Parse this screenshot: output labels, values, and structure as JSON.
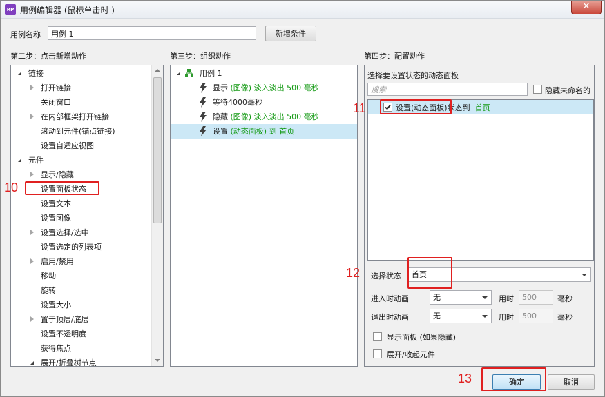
{
  "window": {
    "title": "用例编辑器 (鼠标单击时 )",
    "app_icon": "RP",
    "close_glyph": "✕"
  },
  "case_name": {
    "label": "用例名称",
    "value": "用例 1",
    "add_condition": "新增条件"
  },
  "step2": {
    "heading": "第二步：点击新增动作",
    "tree": [
      {
        "label": "链接",
        "level": 0,
        "expander": "open"
      },
      {
        "label": "打开链接",
        "level": 1,
        "expander": "closed"
      },
      {
        "label": "关闭窗口",
        "level": 1,
        "expander": "none"
      },
      {
        "label": "在内部框架打开链接",
        "level": 1,
        "expander": "closed"
      },
      {
        "label": "滚动到元件(锚点链接)",
        "level": 1,
        "expander": "none"
      },
      {
        "label": "设置自适应视图",
        "level": 1,
        "expander": "none"
      },
      {
        "label": "元件",
        "level": 0,
        "expander": "open"
      },
      {
        "label": "显示/隐藏",
        "level": 1,
        "expander": "closed"
      },
      {
        "label": "设置面板状态",
        "level": 1,
        "expander": "none"
      },
      {
        "label": "设置文本",
        "level": 1,
        "expander": "none"
      },
      {
        "label": "设置图像",
        "level": 1,
        "expander": "none"
      },
      {
        "label": "设置选择/选中",
        "level": 1,
        "expander": "closed"
      },
      {
        "label": "设置选定的列表项",
        "level": 1,
        "expander": "none"
      },
      {
        "label": "启用/禁用",
        "level": 1,
        "expander": "closed"
      },
      {
        "label": "移动",
        "level": 1,
        "expander": "none"
      },
      {
        "label": "旋转",
        "level": 1,
        "expander": "none"
      },
      {
        "label": "设置大小",
        "level": 1,
        "expander": "none"
      },
      {
        "label": "置于顶层/底层",
        "level": 1,
        "expander": "closed"
      },
      {
        "label": "设置不透明度",
        "level": 1,
        "expander": "none"
      },
      {
        "label": "获得焦点",
        "level": 1,
        "expander": "none"
      },
      {
        "label": "展开/折叠树节点",
        "level": 1,
        "expander": "open"
      }
    ]
  },
  "step3": {
    "heading": "第三步：组织动作",
    "case_label": "用例 1",
    "actions": [
      {
        "verb": "显示",
        "target": "(图像)",
        "detail": "淡入淡出 500 毫秒",
        "selected": false
      },
      {
        "verb": "等待4000毫秒",
        "target": "",
        "detail": "",
        "selected": false
      },
      {
        "verb": "隐藏",
        "target": "(图像)",
        "detail": "淡入淡出 500 毫秒",
        "selected": false
      },
      {
        "verb": "设置",
        "target": "(动态面板)",
        "detail": "到 首页",
        "selected": true
      }
    ]
  },
  "step4": {
    "heading": "第四步：配置动作",
    "subheading": "选择要设置状态的动态面板",
    "search_placeholder": "搜索",
    "hide_unnamed_label": "隐藏未命名的",
    "panel_item": {
      "prefix": "设置",
      "target": "(动态面板)",
      "middle": "状态到",
      "state": "首页",
      "checked": true
    },
    "select_state_label": "选择状态",
    "select_state_value": "首页",
    "enter_anim_label": "进入时动画",
    "enter_anim_value": "无",
    "exit_anim_label": "退出时动画",
    "exit_anim_value": "无",
    "duration_label": "用时",
    "duration_value": "500",
    "ms_label": "毫秒",
    "show_panel_label": "显示面板 (如果隐藏)",
    "expand_collapse_label": "展开/收起元件"
  },
  "footer": {
    "ok_label": "确定",
    "cancel_label": "取消"
  },
  "annotations": {
    "n10": "10",
    "n11": "11",
    "n12": "12",
    "n13": "13"
  },
  "colors": {
    "annotation_red": "#e02020",
    "green_text": "#149a14",
    "selection_blue": "#cce8f6"
  }
}
